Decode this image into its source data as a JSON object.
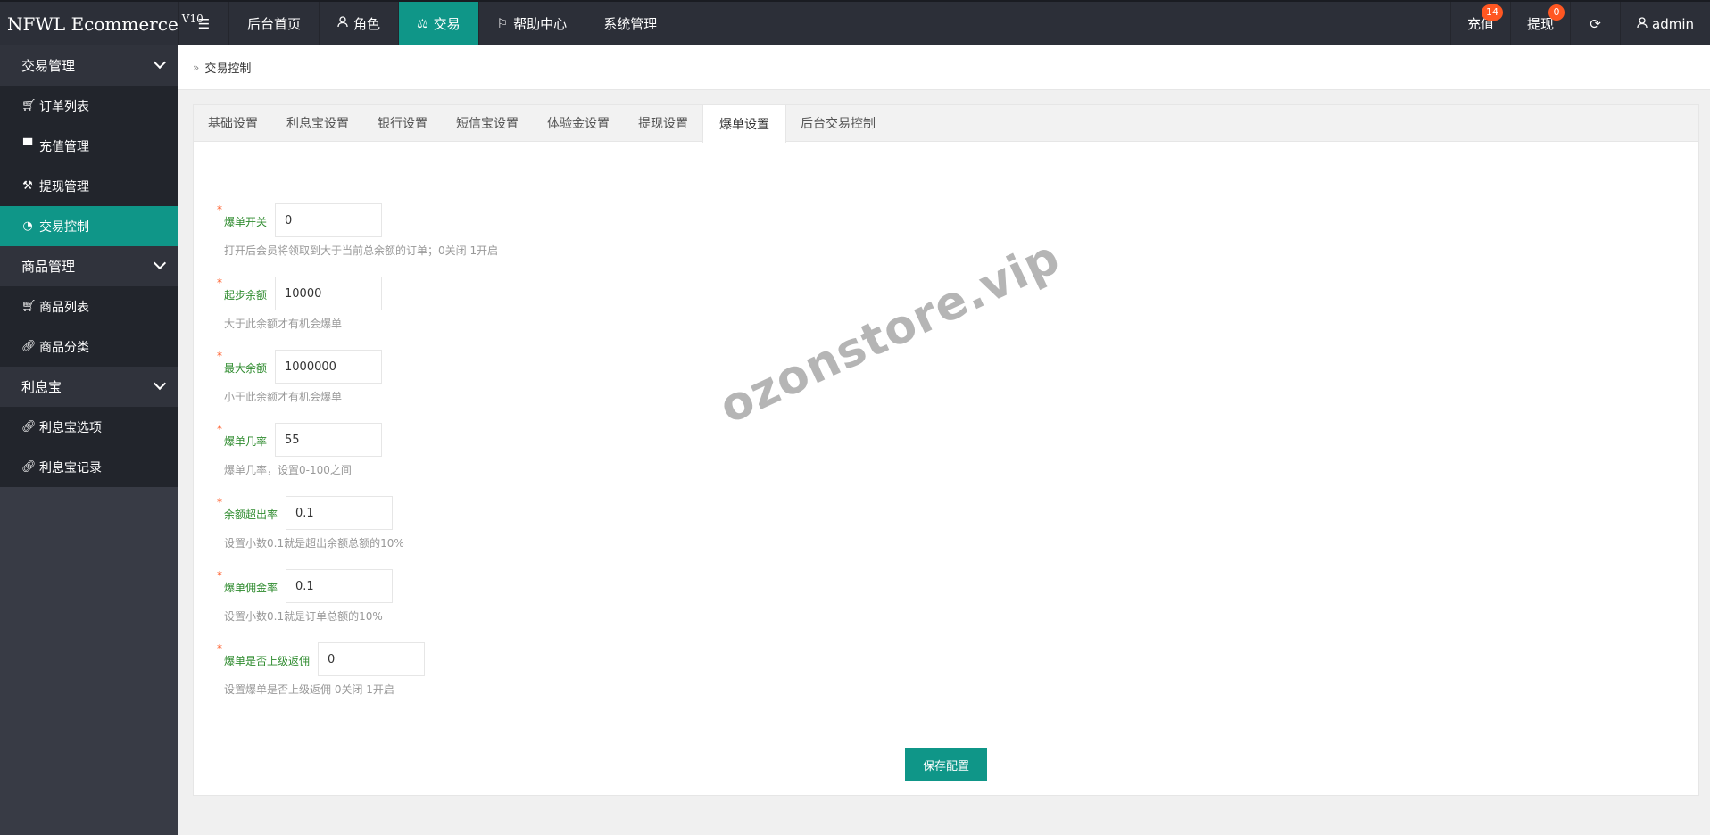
{
  "app": {
    "logo": "NFWL Ecommerce",
    "version": "V10"
  },
  "topnav": {
    "menu_icon": "hamburger-icon",
    "items": [
      {
        "label": "后台首页",
        "icon": ""
      },
      {
        "label": "角色",
        "icon": "user-icon"
      },
      {
        "label": "交易",
        "icon": "scale-icon",
        "active": true
      },
      {
        "label": "帮助中心",
        "icon": "flag-icon"
      },
      {
        "label": "系统管理",
        "icon": ""
      }
    ]
  },
  "topright": {
    "recharge": {
      "label": "充值",
      "badge": "14"
    },
    "withdraw": {
      "label": "提现",
      "badge": "0"
    },
    "refresh_icon": "refresh-icon",
    "user": {
      "label": "admin",
      "icon": "user-icon"
    }
  },
  "sidebar": {
    "groups": [
      {
        "label": "交易管理",
        "items": [
          {
            "label": "订单列表",
            "icon": "cart-icon"
          },
          {
            "label": "充值管理",
            "icon": "chat-icon"
          },
          {
            "label": "提现管理",
            "icon": "gavel-icon"
          },
          {
            "label": "交易控制",
            "icon": "gauge-icon",
            "active": true
          }
        ]
      },
      {
        "label": "商品管理",
        "items": [
          {
            "label": "商品列表",
            "icon": "cart-icon"
          },
          {
            "label": "商品分类",
            "icon": "link-icon"
          }
        ]
      },
      {
        "label": "利息宝",
        "items": [
          {
            "label": "利息宝选项",
            "icon": "link-icon"
          },
          {
            "label": "利息宝记录",
            "icon": "link-icon"
          }
        ]
      }
    ]
  },
  "breadcrumb": {
    "label": "交易控制"
  },
  "tabs": [
    "基础设置",
    "利息宝设置",
    "银行设置",
    "短信宝设置",
    "体验金设置",
    "提现设置",
    "爆单设置",
    "后台交易控制"
  ],
  "active_tab": "爆单设置",
  "form": {
    "fields": [
      {
        "label": "爆单开关",
        "value": "0",
        "hint": "打开后会员将领取到大于当前总余额的订单；0关闭 1开启"
      },
      {
        "label": "起步余额",
        "value": "10000",
        "hint": "大于此余额才有机会爆单"
      },
      {
        "label": "最大余额",
        "value": "1000000",
        "hint": "小于此余额才有机会爆单"
      },
      {
        "label": "爆单几率",
        "value": "55",
        "hint": "爆单几率，设置0-100之间"
      },
      {
        "label": "余额超出率",
        "value": "0.1",
        "hint": "设置小数0.1就是超出余额总额的10%"
      },
      {
        "label": "爆单佣金率",
        "value": "0.1",
        "hint": "设置小数0.1就是订单总额的10%"
      },
      {
        "label": "爆单是否上级返佣",
        "value": "0",
        "hint": "设置爆单是否上级返佣 0关闭 1开启"
      }
    ],
    "save_label": "保存配置"
  },
  "watermark": "ozonstore.vip",
  "colors": {
    "accent": "#0f9688",
    "topbar": "#2c2f38",
    "sidebar": "#383b45",
    "badge": "#ff5722",
    "label": "#2e8b2e"
  }
}
